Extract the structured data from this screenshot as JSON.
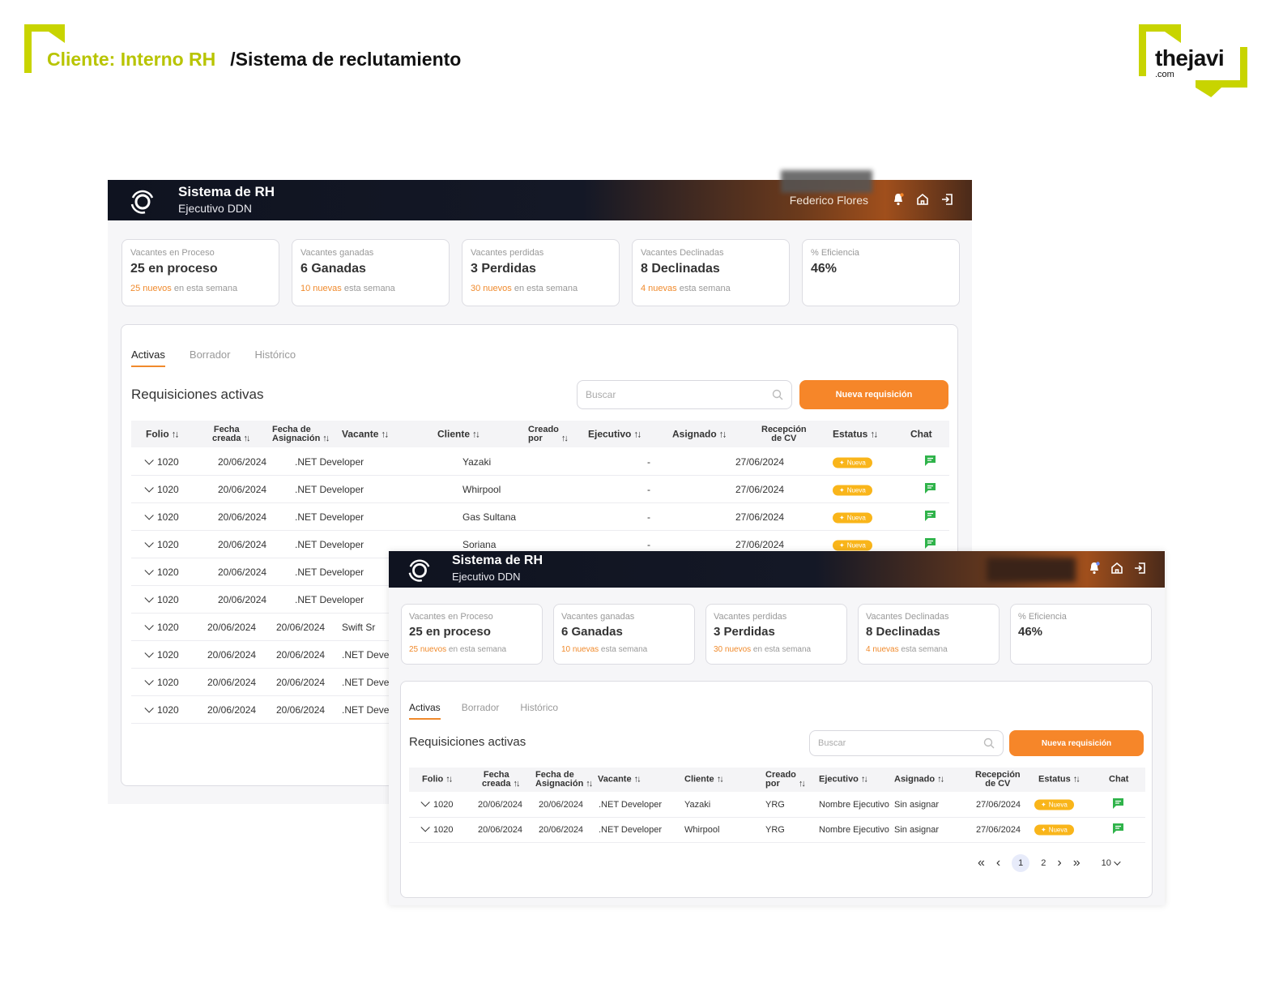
{
  "slide": {
    "client": "Cliente: Interno RH",
    "system": "/Sistema de reclutamiento",
    "logo_word": "thejavi",
    "logo_com": ".com"
  },
  "app": {
    "title": "Sistema de RH",
    "subtitle": "Ejecutivo DDN",
    "user": "Federico Flores"
  },
  "kpis": [
    {
      "label": "Vacantes en Proceso",
      "value": "25 en proceso",
      "sub_hl": "25 nuevos",
      "sub": " en esta semana"
    },
    {
      "label": "Vacantes ganadas",
      "value": "6 Ganadas",
      "sub_hl": "10 nuevas",
      "sub": " esta semana"
    },
    {
      "label": "Vacantes perdidas",
      "value": "3 Perdidas",
      "sub_hl": "30 nuevos",
      "sub": " en esta semana"
    },
    {
      "label": "Vacantes Declinadas",
      "value": "8 Declinadas",
      "sub_hl": "4 nuevas",
      "sub": " esta semana"
    },
    {
      "label": "% Eficiencia",
      "value": "46%",
      "sub_hl": "",
      "sub": ""
    }
  ],
  "kpis2": [
    {
      "label": "Vacantes en Proceso",
      "value": "25 en proceso",
      "sub_hl": "25 nuevos",
      "sub": " en esta semana"
    },
    {
      "label": "Vacantes ganadas",
      "value": "6 Ganadas",
      "sub_hl": "10 nuevas",
      "sub": " esta semana"
    },
    {
      "label": "Vacantes perdidas",
      "value": "3 Perdidas",
      "sub_hl": "30 nuevos",
      "sub": " en esta semana"
    },
    {
      "label": "Vacantes Declinadas",
      "value": "8 Declinadas",
      "sub_hl": "4 nuevas",
      "sub": " esta semana"
    },
    {
      "label": "% Eficiencia",
      "value": "46%",
      "sub_hl": "",
      "sub": ""
    }
  ],
  "tabs": [
    "Activas",
    "Borrador",
    "Histórico"
  ],
  "section_title": "Requisiciones activas",
  "search_placeholder": "Buscar",
  "new_button": "Nueva requisición",
  "badge_label": "Nueva",
  "headers": {
    "folio": "Folio",
    "fecha1": "Fecha",
    "fecha2": "creada",
    "asig1": "Fecha de",
    "asig2": "Asignación",
    "vacante": "Vacante",
    "cliente": "Cliente",
    "creado1": "Creado",
    "creado2": "por",
    "ejecutivo": "Ejecutivo",
    "asignado": "Asignado",
    "recep1": "Recepción",
    "recep2": "de CV",
    "estatus": "Estatus",
    "chat": "Chat",
    "arrows": "↑↓"
  },
  "table1_top": [
    {
      "folio": "1020",
      "fecha": "20/06/2024",
      "vacante": ".NET Developer",
      "cliente": "Yazaki",
      "ejecutivo": "-",
      "recepcion": "27/06/2024"
    },
    {
      "folio": "1020",
      "fecha": "20/06/2024",
      "vacante": ".NET Developer",
      "cliente": "Whirpool",
      "ejecutivo": "-",
      "recepcion": "27/06/2024"
    },
    {
      "folio": "1020",
      "fecha": "20/06/2024",
      "vacante": ".NET Developer",
      "cliente": "Gas Sultana",
      "ejecutivo": "-",
      "recepcion": "27/06/2024"
    },
    {
      "folio": "1020",
      "fecha": "20/06/2024",
      "vacante": ".NET Developer",
      "cliente": "Soriana",
      "ejecutivo": "-",
      "recepcion": "27/06/2024"
    },
    {
      "folio": "1020",
      "fecha": "20/06/2024",
      "vacante": ".NET Developer"
    },
    {
      "folio": "1020",
      "fecha": "20/06/2024",
      "vacante": ".NET Developer"
    }
  ],
  "table1_bottom": [
    {
      "folio": "1020",
      "fecha": "20/06/2024",
      "asig": "20/06/2024",
      "vacante": "Swift Sr"
    },
    {
      "folio": "1020",
      "fecha": "20/06/2024",
      "asig": "20/06/2024",
      "vacante": ".NET Devel"
    },
    {
      "folio": "1020",
      "fecha": "20/06/2024",
      "asig": "20/06/2024",
      "vacante": ".NET Devel"
    },
    {
      "folio": "1020",
      "fecha": "20/06/2024",
      "asig": "20/06/2024",
      "vacante": ".NET Devel"
    }
  ],
  "table2": [
    {
      "folio": "1020",
      "fecha": "20/06/2024",
      "asig": "20/06/2024",
      "vacante": ".NET Developer",
      "cliente": "Yazaki",
      "creado": "YRG",
      "ejecutivo": "Nombre Ejecutivo",
      "asignado": "Sin asignar",
      "recepcion": "27/06/2024"
    },
    {
      "folio": "1020",
      "fecha": "20/06/2024",
      "asig": "20/06/2024",
      "vacante": ".NET Developer",
      "cliente": "Whirpool",
      "creado": "YRG",
      "ejecutivo": "Nombre Ejecutivo",
      "asignado": "Sin asignar",
      "recepcion": "27/06/2024"
    }
  ],
  "pager": {
    "first": "«",
    "prev": "‹",
    "current": "1",
    "next_page": "2",
    "next": "›",
    "last": "»",
    "size": "10"
  },
  "colors": {
    "accent": "#f68629",
    "brand": "#c8d400",
    "badge": "#f9b51a",
    "chat": "#2fb34a"
  }
}
